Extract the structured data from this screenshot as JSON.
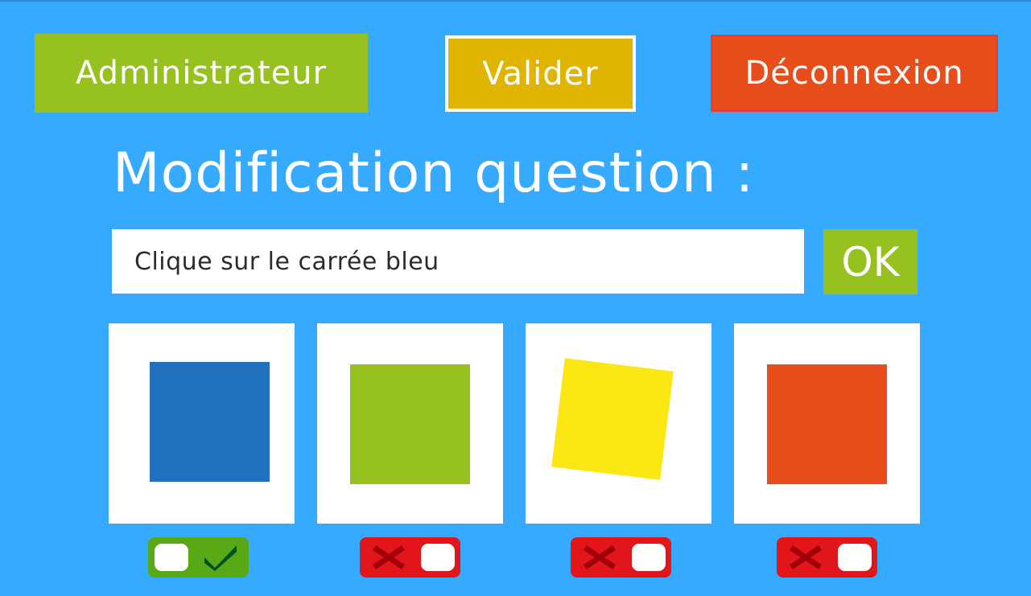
{
  "header": {
    "admin_label": "Administrateur",
    "validate_label": "Valider",
    "logout_label": "Déconnexion"
  },
  "title": "Modification question :",
  "question": {
    "value": "Clique sur le carrée bleu",
    "ok_label": "OK"
  },
  "answers": [
    {
      "color": "#2172be",
      "correct": true
    },
    {
      "color": "#96c11f",
      "correct": false
    },
    {
      "color": "#fbe711",
      "correct": false
    },
    {
      "color": "#e84e1b",
      "correct": false
    }
  ],
  "colors": {
    "background": "#36aaff",
    "toggle_on": "#59a816",
    "toggle_off": "#e2151b",
    "check_mark": "#005127",
    "cross_mark": "#a1000a"
  },
  "icons": {
    "on": "check-icon",
    "off": "cross-icon"
  }
}
